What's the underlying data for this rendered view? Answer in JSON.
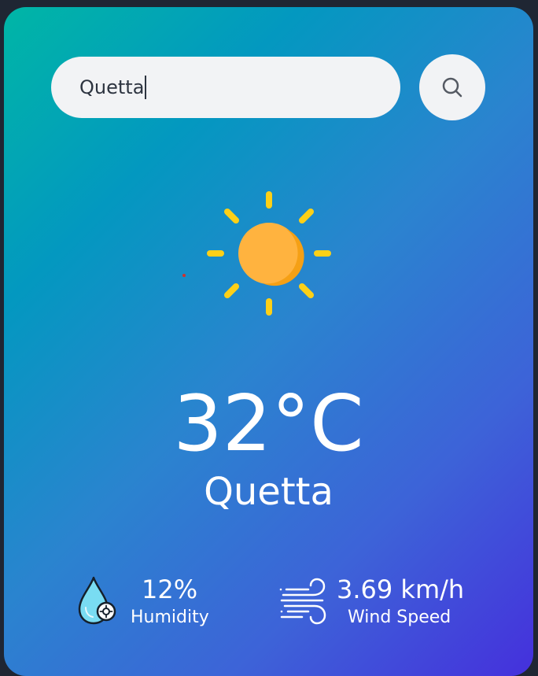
{
  "search": {
    "value": "Quetta",
    "button_icon": "search-icon"
  },
  "weather": {
    "icon": "sun-icon",
    "temperature": "32°C",
    "city": "Quetta"
  },
  "humidity": {
    "icon": "humidity-drop-icon",
    "value": "12%",
    "label": "Humidity"
  },
  "wind": {
    "icon": "wind-icon",
    "value": "3.69 km/h",
    "label": "Wind Speed"
  },
  "colors": {
    "gradient_start": "#00b6a6",
    "gradient_end": "#4530dc",
    "sun_rays": "#fdd017",
    "sun_body": "#ffb33f",
    "text": "#ffffff",
    "input_bg": "#f2f3f5"
  }
}
